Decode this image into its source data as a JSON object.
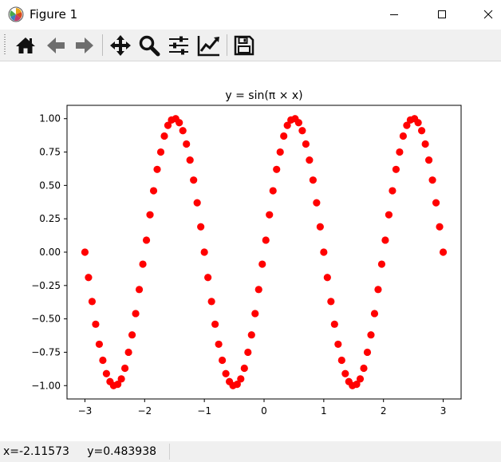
{
  "window": {
    "title": "Figure 1",
    "controls": [
      "minimize-icon",
      "maximize-icon",
      "close-icon"
    ]
  },
  "toolbar": {
    "tools": [
      {
        "name": "home-button",
        "icon": "home-icon"
      },
      {
        "name": "back-button",
        "icon": "arrow-left-icon"
      },
      {
        "name": "forward-button",
        "icon": "arrow-right-icon"
      },
      {
        "name": "pan-button",
        "icon": "move-icon"
      },
      {
        "name": "zoom-button",
        "icon": "magnifier-icon"
      },
      {
        "name": "configure-subplots-button",
        "icon": "sliders-icon"
      },
      {
        "name": "edit-axes-button",
        "icon": "line-chart-icon"
      },
      {
        "name": "save-button",
        "icon": "floppy-disk-icon"
      }
    ]
  },
  "status": {
    "coords": "x=-2.11573     y=0.483938"
  },
  "colors": {
    "marker": "#ff0000",
    "toolbar_bg": "#f0f0f0"
  },
  "chart_data": {
    "type": "scatter",
    "title": "y = sin(π × x)",
    "xlabel": "",
    "ylabel": "",
    "xlim": [
      -3.3,
      3.3
    ],
    "ylim": [
      -1.1,
      1.1
    ],
    "xticks": [
      -3,
      -2,
      -1,
      0,
      1,
      2,
      3
    ],
    "xtick_labels": [
      "−3",
      "−2",
      "−1",
      "0",
      "1",
      "2",
      "3"
    ],
    "yticks": [
      -1.0,
      -0.75,
      -0.5,
      -0.25,
      0.0,
      0.25,
      0.5,
      0.75,
      1.0
    ],
    "ytick_labels": [
      "−1.00",
      "−0.75",
      "−0.50",
      "−0.25",
      "0.00",
      "0.25",
      "0.50",
      "0.75",
      "1.00"
    ],
    "grid": false,
    "marker_color": "#ff0000",
    "series": [
      {
        "x": [
          -3.0,
          -2.94,
          -2.88,
          -2.82,
          -2.76,
          -2.7,
          -2.64,
          -2.58,
          -2.52,
          -2.45,
          -2.39,
          -2.33,
          -2.27,
          -2.21,
          -2.15,
          -2.09,
          -2.03,
          -1.97,
          -1.91,
          -1.85,
          -1.79,
          -1.73,
          -1.67,
          -1.61,
          -1.55,
          -1.48,
          -1.42,
          -1.36,
          -1.3,
          -1.24,
          -1.18,
          -1.12,
          -1.06,
          -1.0,
          -0.94,
          -0.88,
          -0.82,
          -0.76,
          -0.7,
          -0.64,
          -0.58,
          -0.52,
          -0.45,
          -0.39,
          -0.33,
          -0.27,
          -0.21,
          -0.15,
          -0.09,
          -0.03,
          0.03,
          0.09,
          0.15,
          0.21,
          0.27,
          0.33,
          0.39,
          0.45,
          0.52,
          0.58,
          0.64,
          0.7,
          0.76,
          0.82,
          0.88,
          0.94,
          1.0,
          1.06,
          1.12,
          1.18,
          1.24,
          1.3,
          1.36,
          1.42,
          1.48,
          1.55,
          1.61,
          1.67,
          1.73,
          1.79,
          1.85,
          1.91,
          1.97,
          2.03,
          2.09,
          2.15,
          2.21,
          2.27,
          2.33,
          2.39,
          2.45,
          2.52,
          2.58,
          2.64,
          2.7,
          2.76,
          2.82,
          2.88,
          2.94,
          3.0
        ],
        "y": [
          0.0,
          -0.19,
          -0.37,
          -0.54,
          -0.69,
          -0.81,
          -0.91,
          -0.97,
          -1.0,
          -0.99,
          -0.95,
          -0.87,
          -0.75,
          -0.62,
          -0.46,
          -0.28,
          -0.09,
          0.09,
          0.28,
          0.46,
          0.62,
          0.75,
          0.87,
          0.95,
          0.99,
          1.0,
          0.97,
          0.91,
          0.81,
          0.69,
          0.54,
          0.37,
          0.19,
          0.0,
          -0.19,
          -0.37,
          -0.54,
          -0.69,
          -0.81,
          -0.91,
          -0.97,
          -1.0,
          -0.99,
          -0.95,
          -0.87,
          -0.75,
          -0.62,
          -0.46,
          -0.28,
          -0.09,
          0.09,
          0.28,
          0.46,
          0.62,
          0.75,
          0.87,
          0.95,
          0.99,
          1.0,
          0.97,
          0.91,
          0.81,
          0.69,
          0.54,
          0.37,
          0.19,
          0.0,
          -0.19,
          -0.37,
          -0.54,
          -0.69,
          -0.81,
          -0.91,
          -0.97,
          -1.0,
          -0.99,
          -0.95,
          -0.87,
          -0.75,
          -0.62,
          -0.46,
          -0.28,
          -0.09,
          0.09,
          0.28,
          0.46,
          0.62,
          0.75,
          0.87,
          0.95,
          0.99,
          1.0,
          0.97,
          0.91,
          0.81,
          0.69,
          0.54,
          0.37,
          0.19,
          0.0
        ]
      }
    ]
  }
}
